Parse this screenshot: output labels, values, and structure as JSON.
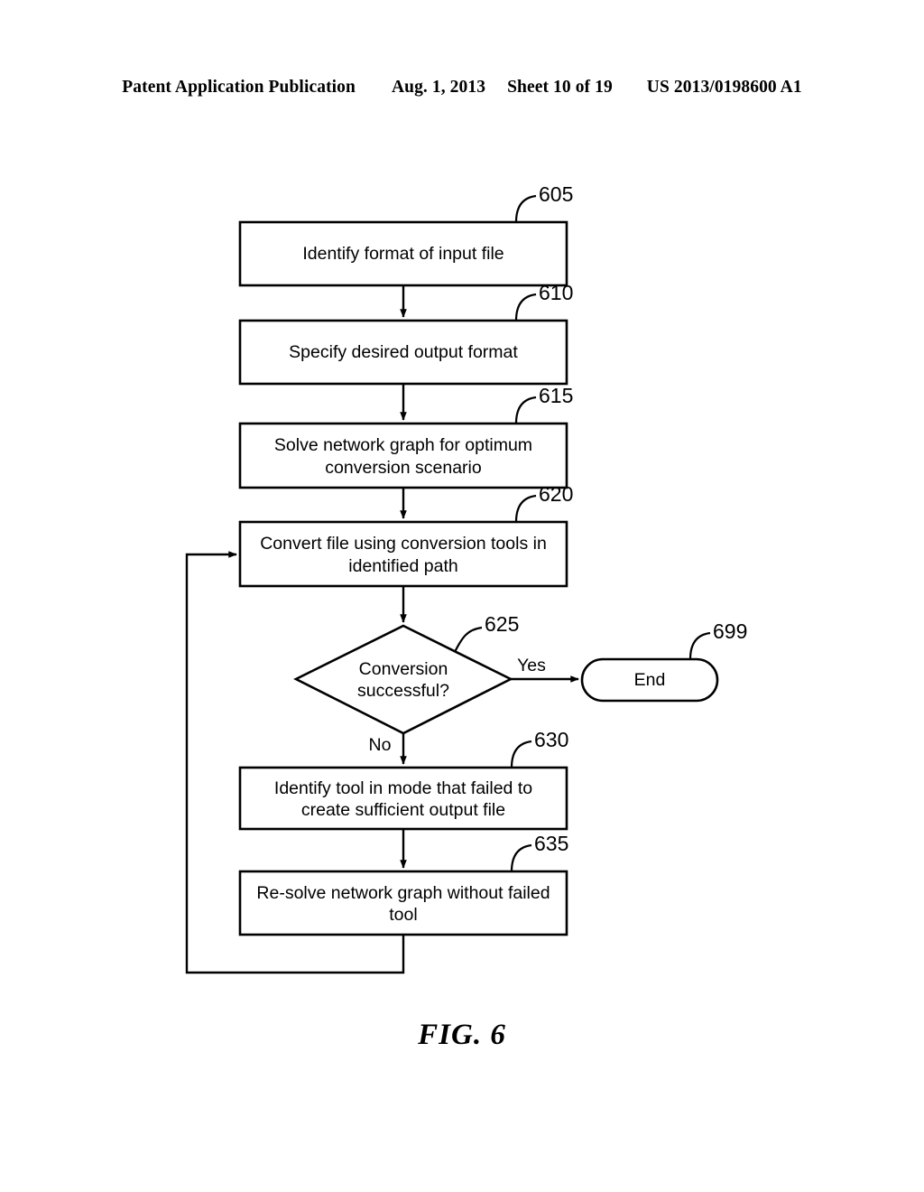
{
  "header": {
    "publication": "Patent Application Publication",
    "date": "Aug. 1, 2013",
    "sheet": "Sheet 10 of 19",
    "number": "US 2013/0198600 A1"
  },
  "figure": {
    "caption": "FIG. 6"
  },
  "flowchart": {
    "nodes": [
      {
        "ref": "605",
        "text_line1": "Identify format of input file",
        "text_line2": "",
        "shape": "process"
      },
      {
        "ref": "610",
        "text_line1": "Specify desired output format",
        "text_line2": "",
        "shape": "process"
      },
      {
        "ref": "615",
        "text_line1": "Solve network graph for optimum",
        "text_line2": "conversion scenario",
        "shape": "process"
      },
      {
        "ref": "620",
        "text_line1": "Convert file using conversion tools in",
        "text_line2": "identified path",
        "shape": "process"
      },
      {
        "ref": "625",
        "text_line1": "Conversion",
        "text_line2": "successful?",
        "shape": "decision"
      },
      {
        "ref": "699",
        "text_line1": "End",
        "text_line2": "",
        "shape": "terminator"
      },
      {
        "ref": "630",
        "text_line1": "Identify tool in mode that failed to",
        "text_line2": "create sufficient output file",
        "shape": "process"
      },
      {
        "ref": "635",
        "text_line1": "Re-solve network graph without failed",
        "text_line2": "tool",
        "shape": "process"
      }
    ],
    "edge_labels": {
      "yes": "Yes",
      "no": "No"
    }
  }
}
